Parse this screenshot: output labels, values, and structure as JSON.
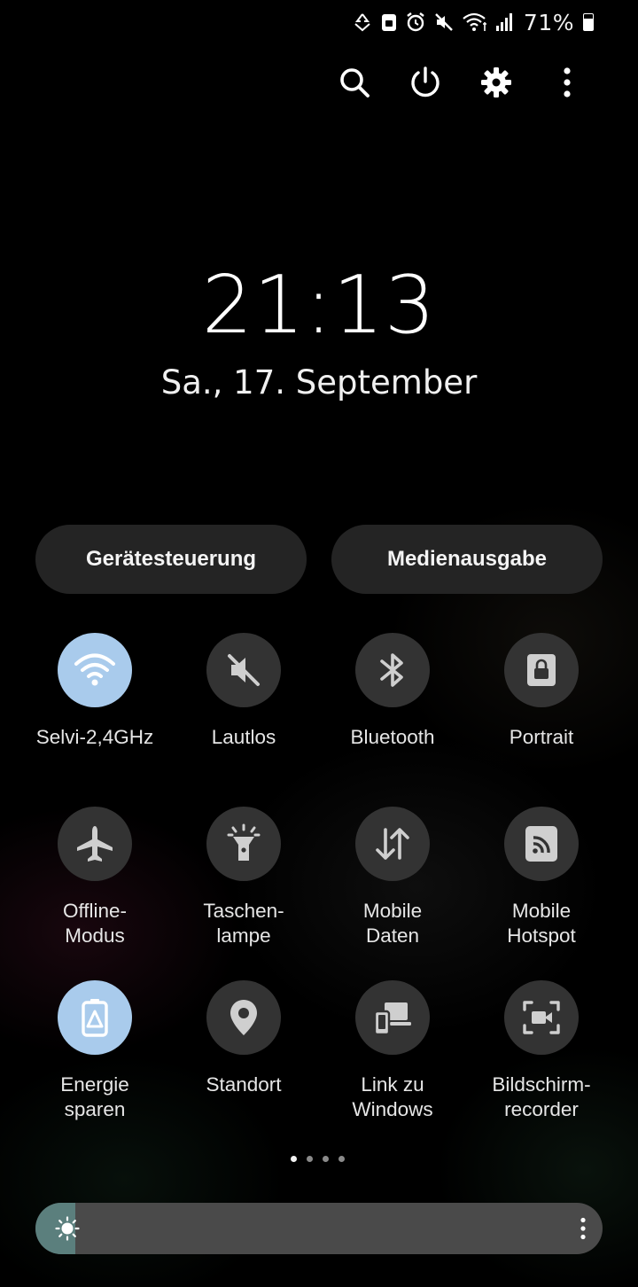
{
  "status_bar": {
    "battery_percent": "71%",
    "battery_level": 0.71,
    "icons": [
      "sync-icon",
      "lock-badge-icon",
      "alarm-icon",
      "mute-icon",
      "wifi-calling-icon",
      "signal-icon",
      "battery-icon"
    ]
  },
  "top_actions": [
    "search-icon",
    "power-icon",
    "settings-icon",
    "more-vert-icon"
  ],
  "clock": {
    "time": "21:13",
    "date": "Sa., 17. September"
  },
  "buttons": {
    "device_control": "Gerätesteuerung",
    "media_output": "Medienausgabe"
  },
  "tiles": [
    {
      "label": "Selvi-2,4GHz",
      "icon": "wifi-icon",
      "active": true
    },
    {
      "label": "Lautlos",
      "icon": "mute-icon",
      "active": false
    },
    {
      "label": "Bluetooth",
      "icon": "bluetooth-icon",
      "active": false
    },
    {
      "label": "Portrait",
      "icon": "rotation-lock-icon",
      "active": false
    },
    {
      "label": "Offline-\nModus",
      "icon": "airplane-icon",
      "active": false
    },
    {
      "label": "Taschen-\nlampe",
      "icon": "flashlight-icon",
      "active": false
    },
    {
      "label": "Mobile\nDaten",
      "icon": "mobile-data-icon",
      "active": false
    },
    {
      "label": "Mobile\nHotspot",
      "icon": "hotspot-icon",
      "active": false
    },
    {
      "label": "Energie\nsparen",
      "icon": "power-saving-icon",
      "active": true
    },
    {
      "label": "Standort",
      "icon": "location-icon",
      "active": false
    },
    {
      "label": "Link zu\nWindows",
      "icon": "link-to-windows-icon",
      "active": false
    },
    {
      "label": "Bildschirm-\nrecorder",
      "icon": "screen-recorder-icon",
      "active": false
    }
  ],
  "pager": {
    "pages": 4,
    "current": 1
  },
  "brightness": {
    "level": 0.07
  },
  "colors": {
    "active_tile": "#a9cbec",
    "inactive_tile": "#333333",
    "brightness_fill": "#5b7f7d"
  }
}
